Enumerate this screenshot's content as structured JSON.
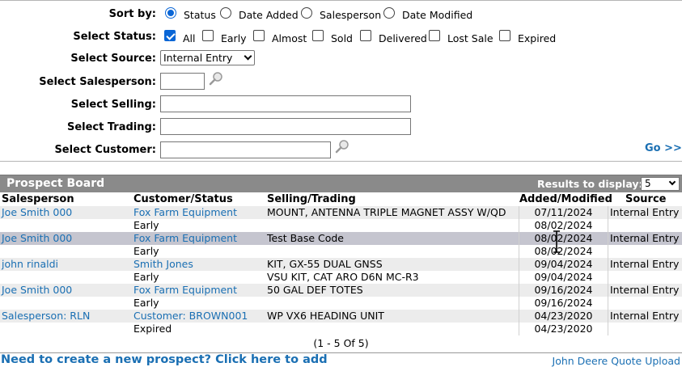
{
  "form": {
    "sort_by": {
      "label": "Sort by:",
      "options": [
        "Status",
        "Date Added",
        "Salesperson",
        "Date Modified"
      ],
      "selected": "Status"
    },
    "status": {
      "label": "Select Status:",
      "options": [
        {
          "label": "All",
          "checked": true
        },
        {
          "label": "Early",
          "checked": false
        },
        {
          "label": "Almost",
          "checked": false
        },
        {
          "label": "Sold",
          "checked": false
        },
        {
          "label": "Delivered",
          "checked": false
        },
        {
          "label": "Lost Sale",
          "checked": false
        },
        {
          "label": "Expired",
          "checked": false
        }
      ]
    },
    "source": {
      "label": "Select Source:",
      "value": "Internal Entry"
    },
    "salesperson": {
      "label": "Select Salesperson:",
      "value": ""
    },
    "selling": {
      "label": "Select Selling:",
      "value": ""
    },
    "trading": {
      "label": "Select Trading:",
      "value": ""
    },
    "customer": {
      "label": "Select Customer:",
      "value": ""
    },
    "go_label": "Go >>"
  },
  "board": {
    "title": "Prospect Board",
    "results_label": "Results to display:",
    "results_value": "5",
    "columns": [
      "Salesperson",
      "Customer/Status",
      "Selling/Trading",
      "Added/Modified",
      "Source"
    ],
    "rows": [
      {
        "salesperson": "Joe Smith 000",
        "customer": "Fox Farm Equipment",
        "status": "Early",
        "selling": "MOUNT, ANTENNA TRIPLE MAGNET ASSY W/QD",
        "trading": "",
        "added": "07/11/2024",
        "modified": "08/02/2024",
        "source": "Internal Entry"
      },
      {
        "salesperson": "Joe Smith 000",
        "customer": "Fox Farm Equipment",
        "status": "Early",
        "selling": "Test Base Code",
        "trading": "",
        "added": "08/02/2024",
        "modified": "08/02/2024",
        "source": "Internal Entry"
      },
      {
        "salesperson": "john rinaldi",
        "customer": "Smith Jones",
        "status": "Early",
        "selling": "KIT, GX-55 DUAL GNSS",
        "trading": "VSU KIT, CAT ARO D6N MC-R3",
        "added": "09/04/2024",
        "modified": "09/04/2024",
        "source": "Internal Entry"
      },
      {
        "salesperson": "Joe Smith 000",
        "customer": "Fox Farm Equipment",
        "status": "Early",
        "selling": "50 GAL DEF TOTES",
        "trading": "",
        "added": "09/16/2024",
        "modified": "09/16/2024",
        "source": "Internal Entry"
      },
      {
        "salesperson": "Salesperson: RLN",
        "customer": "Customer: BROWN001",
        "status": "Expired",
        "selling": "WP VX6 HEADING UNIT",
        "trading": "",
        "added": "04/23/2020",
        "modified": "04/23/2020",
        "source": "Internal Entry"
      }
    ],
    "pager": "(1  -  5  Of  5)"
  },
  "footer": {
    "new_prospect": "Need to create a new prospect? Click here to add",
    "quote_upload": "John Deere Quote Upload"
  },
  "colors": {
    "link": "#1a6fb3",
    "header_bar": "#8a8a8a",
    "selected_row": "#c5c5cf",
    "accent": "#0a66d6"
  }
}
